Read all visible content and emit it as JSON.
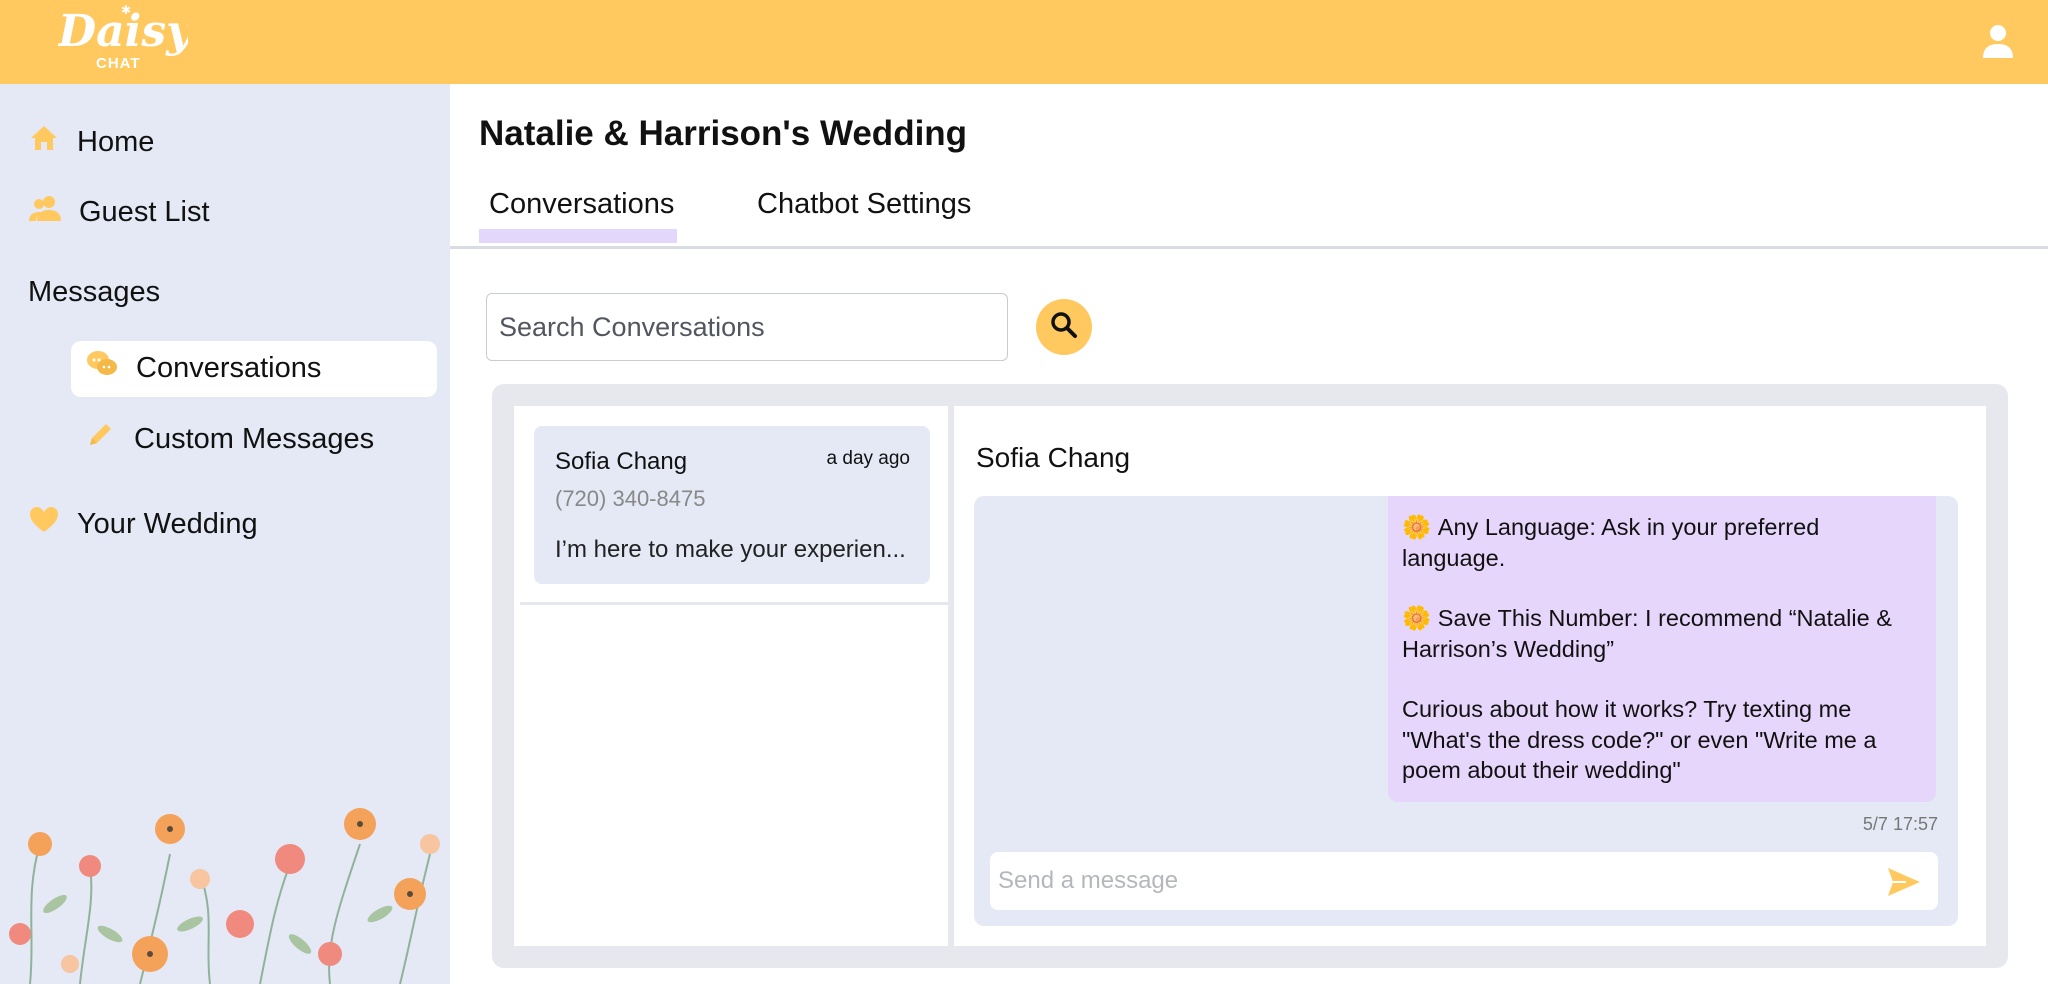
{
  "header": {
    "logo_title": "Daisy",
    "logo_subtitle": "CHAT",
    "user_icon": "user-icon",
    "accent_color": "#ffc960"
  },
  "sidebar": {
    "items": [
      {
        "label": "Home",
        "icon": "home-icon"
      },
      {
        "label": "Guest List",
        "icon": "users-icon"
      }
    ],
    "messages_section": "Messages",
    "sub_items": [
      {
        "label": "Conversations",
        "icon": "chat-bubbles-icon",
        "active": true
      },
      {
        "label": "Custom Messages",
        "icon": "pencil-icon",
        "active": false
      }
    ],
    "wedding_item": {
      "label": "Your Wedding",
      "icon": "heart-icon"
    }
  },
  "main": {
    "title": "Natalie & Harrison's Wedding",
    "tabs": [
      {
        "label": "Conversations",
        "active": true
      },
      {
        "label": "Chatbot Settings",
        "active": false
      }
    ],
    "search": {
      "placeholder": "Search Conversations",
      "value": ""
    }
  },
  "conversations": [
    {
      "name": "Sofia Chang",
      "time": "a day ago",
      "phone": "(720) 340-8475",
      "preview": "I’m here to make your experien..."
    }
  ],
  "chat": {
    "title": "Sofia Chang",
    "message": {
      "line1_emoji": "🌼",
      "line1": "Any Language: Ask in your preferred language.",
      "line2_emoji": "🌼",
      "line2": "Save This Number: I recommend “Natalie & Harrison’s Wedding”",
      "line3": "Curious about how it works? Try texting me \"What's the dress code?\" or even \"Write me a poem about their wedding\""
    },
    "timestamp": "5/7 17:57",
    "input_placeholder": "Send a message",
    "send_icon": "send-icon"
  }
}
